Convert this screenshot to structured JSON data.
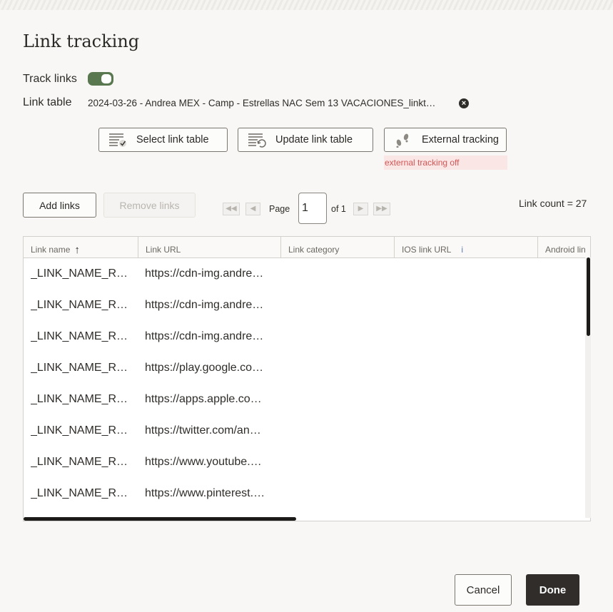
{
  "dialog": {
    "title": "Link tracking"
  },
  "track_links": {
    "label": "Track links",
    "enabled": true
  },
  "link_table": {
    "label": "Link table",
    "value": "2024-03-26 - Andrea MEX - Camp - Estrellas NAC Sem 13 VACACIONES_linkt…",
    "clear_icon": "close-circle-icon"
  },
  "toolbar": {
    "select_label": "Select link table",
    "update_label": "Update link table",
    "external_label": "External tracking",
    "external_status": "external tracking off"
  },
  "actions": {
    "add_label": "Add links",
    "remove_label": "Remove links"
  },
  "pagination": {
    "page_label": "Page",
    "current_page": "1",
    "of_label": "of 1"
  },
  "link_count": "Link count = 27",
  "grid": {
    "columns": [
      "Link name",
      "Link URL",
      "Link category",
      "IOS link URL",
      "Android lin"
    ],
    "info_icon": "i",
    "sort_icon": "↑",
    "rows": [
      {
        "name": "_LINK_NAME_RE…",
        "url": "https://cdn-img.andre…"
      },
      {
        "name": "_LINK_NAME_RE…",
        "url": "https://cdn-img.andre…"
      },
      {
        "name": "_LINK_NAME_RE…",
        "url": "https://cdn-img.andre…"
      },
      {
        "name": "_LINK_NAME_RE…",
        "url": "https://play.google.co…"
      },
      {
        "name": "_LINK_NAME_RE…",
        "url": "https://apps.apple.co…"
      },
      {
        "name": "_LINK_NAME_RE…",
        "url": "https://twitter.com/an…"
      },
      {
        "name": "_LINK_NAME_RE…",
        "url": "https://www.youtube.…"
      },
      {
        "name": "_LINK_NAME_RE…",
        "url": "https://www.pinterest.…"
      }
    ]
  },
  "footer": {
    "cancel_label": "Cancel",
    "done_label": "Done"
  },
  "colors": {
    "accent_toggle": "#5a7850",
    "primary_button": "#312d2a",
    "error_text": "#d05656",
    "error_bg": "#fbe6e6"
  }
}
